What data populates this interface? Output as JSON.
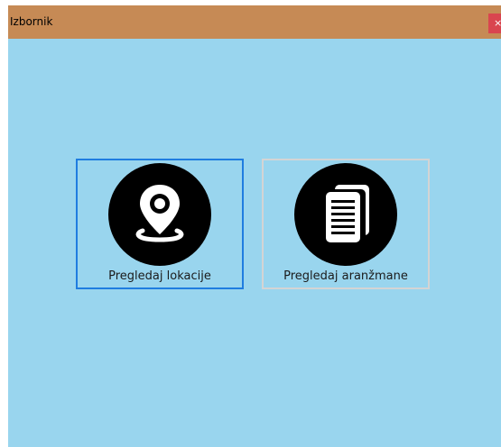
{
  "window": {
    "title": "Izbornik",
    "close_label": "×"
  },
  "tiles": [
    {
      "label": "Pregledaj lokacije",
      "icon": "location-pin-icon"
    },
    {
      "label": "Pregledaj aranžmane",
      "icon": "documents-icon"
    }
  ],
  "colors": {
    "titlebar": "#c68a55",
    "window_background": "#99d5ee",
    "selected_border": "#1f7de0",
    "close_button": "#d9454f"
  }
}
